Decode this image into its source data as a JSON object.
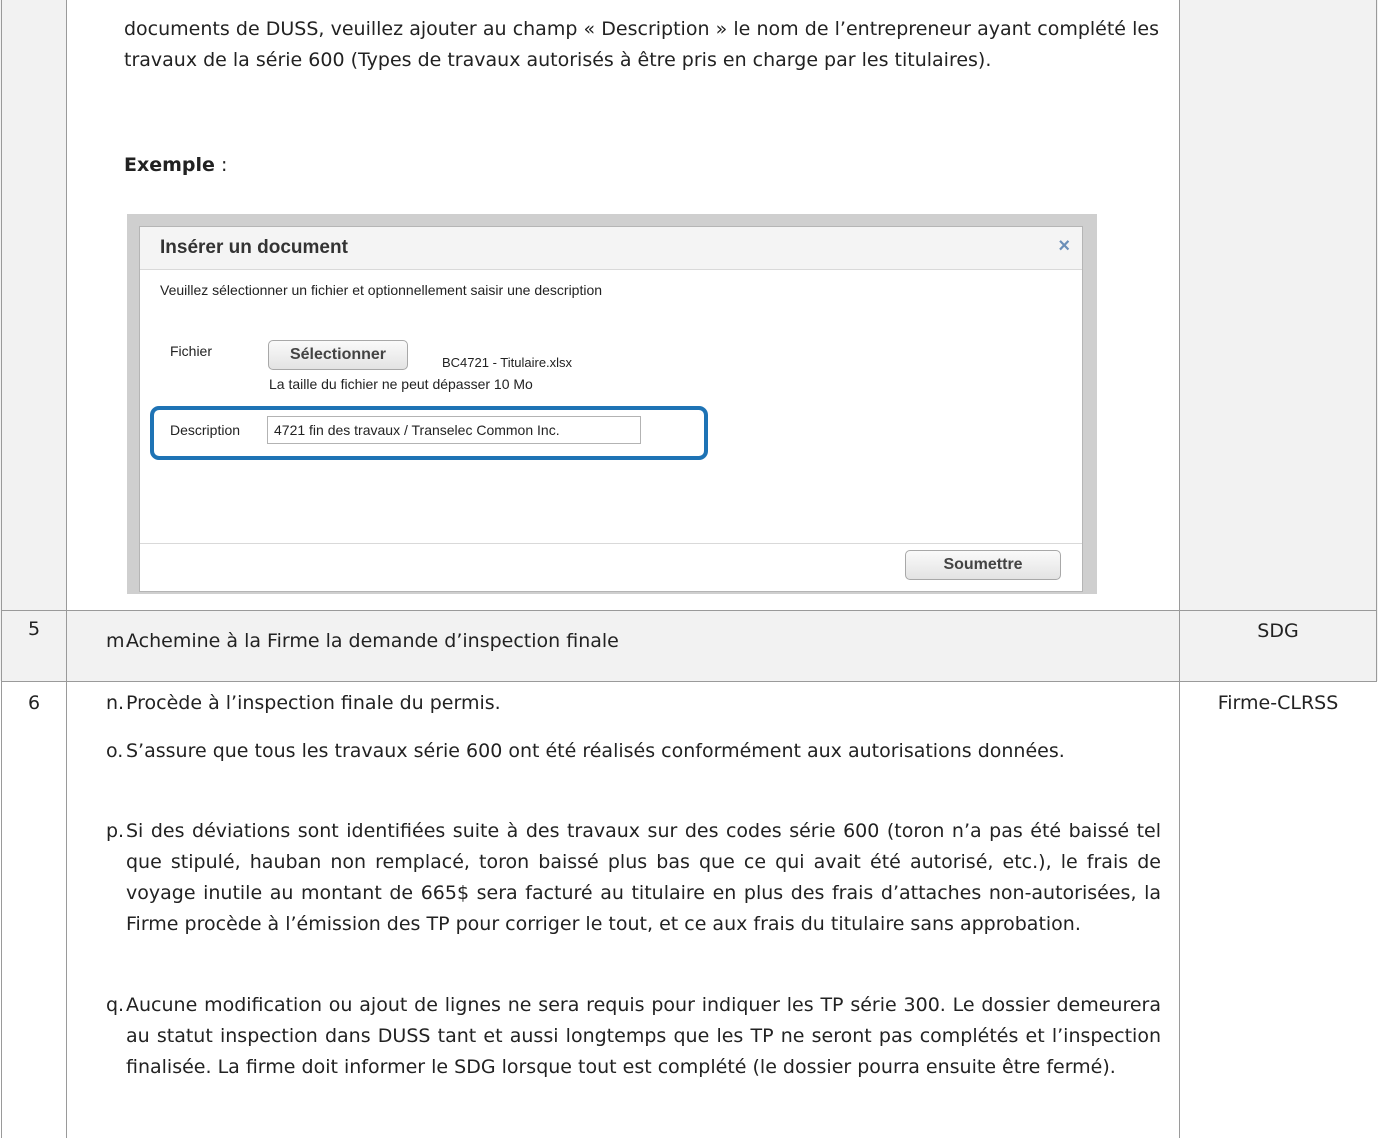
{
  "top_section": {
    "para_1": "documents de DUSS, veuillez ajouter au champ « Description » le nom de l’entrepreneur ayant complété les travaux de la série 600 (Types de travaux autorisés à être pris en charge par les titulaires).",
    "example_label": "Exemple",
    "example_suffix": " :"
  },
  "dialog": {
    "title": "Insérer un document",
    "close_icon": "×",
    "subtitle": "Veuillez sélectionner un fichier et optionnellement saisir une description",
    "file_label": "Fichier",
    "select_button": "Sélectionner",
    "file_name": "BC4721 - Titulaire.xlsx",
    "size_note": "La taille du fichier ne peut dépasser 10 Mo",
    "description_label": "Description",
    "description_value": "4721 fin des travaux / Transelec Common Inc.",
    "submit_button": "Soumettre",
    "highlight_color": "#1e73b5"
  },
  "rows": [
    {
      "number": "5",
      "responsible": "SDG",
      "items": [
        {
          "letter": "m.",
          "text": "Achemine à la Firme la demande d’inspection finale"
        }
      ]
    },
    {
      "number": "6",
      "responsible": "Firme-CLRSS",
      "items": [
        {
          "letter": "n.",
          "text": "Procède à l’inspection finale du permis."
        },
        {
          "letter": "o.",
          "text": "S’assure que tous les travaux série 600 ont été réalisés conformément aux autorisations données."
        },
        {
          "letter": "p.",
          "text": "Si des déviations sont identifiées suite à des travaux sur des codes série 600 (toron n’a pas été baissé tel que stipulé, hauban non remplacé, toron baissé plus bas que ce qui avait été autorisé, etc.), le frais de voyage inutile au montant de 665$ sera facturé au titulaire en plus des frais d’attaches non-autorisées, la Firme procède à l’émission des TP pour corriger le tout, et ce aux frais du titulaire sans approbation."
        },
        {
          "letter": "q.",
          "text": "Aucune modification ou ajout de lignes ne sera requis pour indiquer les TP série 300.  Le dossier demeurera au statut inspection dans DUSS tant et aussi longtemps que les TP ne seront pas complétés et l’inspection finalisée.  La firme doit informer le SDG lorsque tout est complété (le dossier pourra ensuite être fermé)."
        }
      ]
    }
  ],
  "colors": {
    "shade": "#f2f2f2",
    "grid": "#9a9a9a"
  }
}
